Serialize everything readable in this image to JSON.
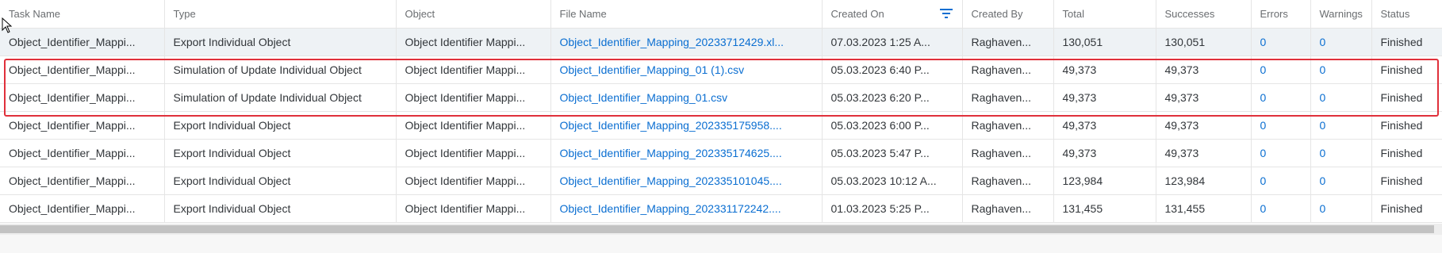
{
  "table": {
    "columns": [
      {
        "label": "Task Name"
      },
      {
        "label": "Type"
      },
      {
        "label": "Object"
      },
      {
        "label": "File Name"
      },
      {
        "label": "Created On",
        "filter_icon": "filter-icon"
      },
      {
        "label": "Created By"
      },
      {
        "label": "Total"
      },
      {
        "label": "Successes"
      },
      {
        "label": "Errors"
      },
      {
        "label": "Warnings"
      },
      {
        "label": "Status"
      }
    ],
    "rows": [
      {
        "task": "Object_Identifier_Mappi...",
        "type": "Export Individual Object",
        "object": "Object Identifier Mappi...",
        "file": "Object_Identifier_Mapping_20233712429.xl...",
        "created_on": "07.03.2023 1:25 A...",
        "created_by": "Raghaven...",
        "total": "130,051",
        "successes": "130,051",
        "errors": "0",
        "warnings": "0",
        "status": "Finished"
      },
      {
        "task": "Object_Identifier_Mappi...",
        "type": "Simulation of Update Individual Object",
        "object": "Object Identifier Mappi...",
        "file": "Object_Identifier_Mapping_01 (1).csv",
        "created_on": "05.03.2023 6:40 P...",
        "created_by": "Raghaven...",
        "total": "49,373",
        "successes": "49,373",
        "errors": "0",
        "warnings": "0",
        "status": "Finished"
      },
      {
        "task": "Object_Identifier_Mappi...",
        "type": "Simulation of Update Individual Object",
        "object": "Object Identifier Mappi...",
        "file": "Object_Identifier_Mapping_01.csv",
        "created_on": "05.03.2023 6:20 P...",
        "created_by": "Raghaven...",
        "total": "49,373",
        "successes": "49,373",
        "errors": "0",
        "warnings": "0",
        "status": "Finished"
      },
      {
        "task": "Object_Identifier_Mappi...",
        "type": "Export Individual Object",
        "object": "Object Identifier Mappi...",
        "file": "Object_Identifier_Mapping_202335175958....",
        "created_on": "05.03.2023 6:00 P...",
        "created_by": "Raghaven...",
        "total": "49,373",
        "successes": "49,373",
        "errors": "0",
        "warnings": "0",
        "status": "Finished"
      },
      {
        "task": "Object_Identifier_Mappi...",
        "type": "Export Individual Object",
        "object": "Object Identifier Mappi...",
        "file": "Object_Identifier_Mapping_202335174625....",
        "created_on": "05.03.2023 5:47 P...",
        "created_by": "Raghaven...",
        "total": "49,373",
        "successes": "49,373",
        "errors": "0",
        "warnings": "0",
        "status": "Finished"
      },
      {
        "task": "Object_Identifier_Mappi...",
        "type": "Export Individual Object",
        "object": "Object Identifier Mappi...",
        "file": "Object_Identifier_Mapping_202335101045....",
        "created_on": "05.03.2023 10:12 A...",
        "created_by": "Raghaven...",
        "total": "123,984",
        "successes": "123,984",
        "errors": "0",
        "warnings": "0",
        "status": "Finished"
      },
      {
        "task": "Object_Identifier_Mappi...",
        "type": "Export Individual Object",
        "object": "Object Identifier Mappi...",
        "file": "Object_Identifier_Mapping_202331172242....",
        "created_on": "01.03.2023 5:25 P...",
        "created_by": "Raghaven...",
        "total": "131,455",
        "successes": "131,455",
        "errors": "0",
        "warnings": "0",
        "status": "Finished"
      }
    ]
  },
  "colors": {
    "link": "#0a6ed1",
    "highlight_border": "#e0303b",
    "selected_row": "#eef2f5"
  }
}
